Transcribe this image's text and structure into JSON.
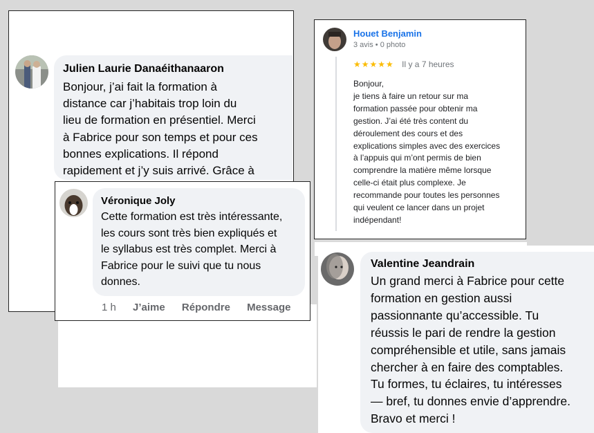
{
  "julien": {
    "name": "Julien Laurie Danaéithanaaron",
    "text": "Bonjour, j’ai fait la formation à\ndistance car j’habitais trop loin du\nlieu de formation en présentiel. Merci\nà Fabrice pour son temps et pour ces\nbonnes explications. Il répond\nrapidement et j’y suis arrivé. Grâce à"
  },
  "veronique": {
    "name": "Véronique Joly",
    "text": "Cette formation est très intéressante,\nles cours sont très bien expliqués et\nle syllabus est très complet.  Merci à\nFabrice pour le suivi que tu nous\ndonnes.",
    "time": "1 h",
    "like": "J’aime",
    "reply": "Répondre",
    "message": "Message"
  },
  "houet": {
    "name": "Houet Benjamin",
    "meta": "3 avis • 0 photo",
    "stars": "★★★★★",
    "when": "Il y a 7 heures",
    "text": "Bonjour,\nje tiens à faire un retour sur ma\nformation passée pour obtenir ma\ngestion. J’ai été très content du\ndéroulement des cours et des\nexplications simples avec des exercices\nà l’appuis qui m’ont permis de bien\ncomprendre la matière même lorsque\ncelle-ci était plus complexe. Je\nrecommande pour toutes les personnes\nqui veulent ce lancer dans un projet\nindépendant!"
  },
  "valentine": {
    "name": "Valentine Jeandrain",
    "text": "Un grand merci à Fabrice pour cette\nformation en gestion aussi\npassionnante qu’accessible. Tu\nréussis le pari de rendre la gestion\ncompréhensible et utile, sans jamais\nchercher à en faire des comptables.\nTu formes, tu éclaires, tu intéresses\n— bref, tu donnes envie d’apprendre.\nBravo et merci !"
  },
  "colors": {
    "background": "#d9d9d9",
    "bubble": "#f0f2f5",
    "google_blue": "#1a73e8",
    "star": "#fbbc04",
    "meta_gray": "#65676b"
  }
}
